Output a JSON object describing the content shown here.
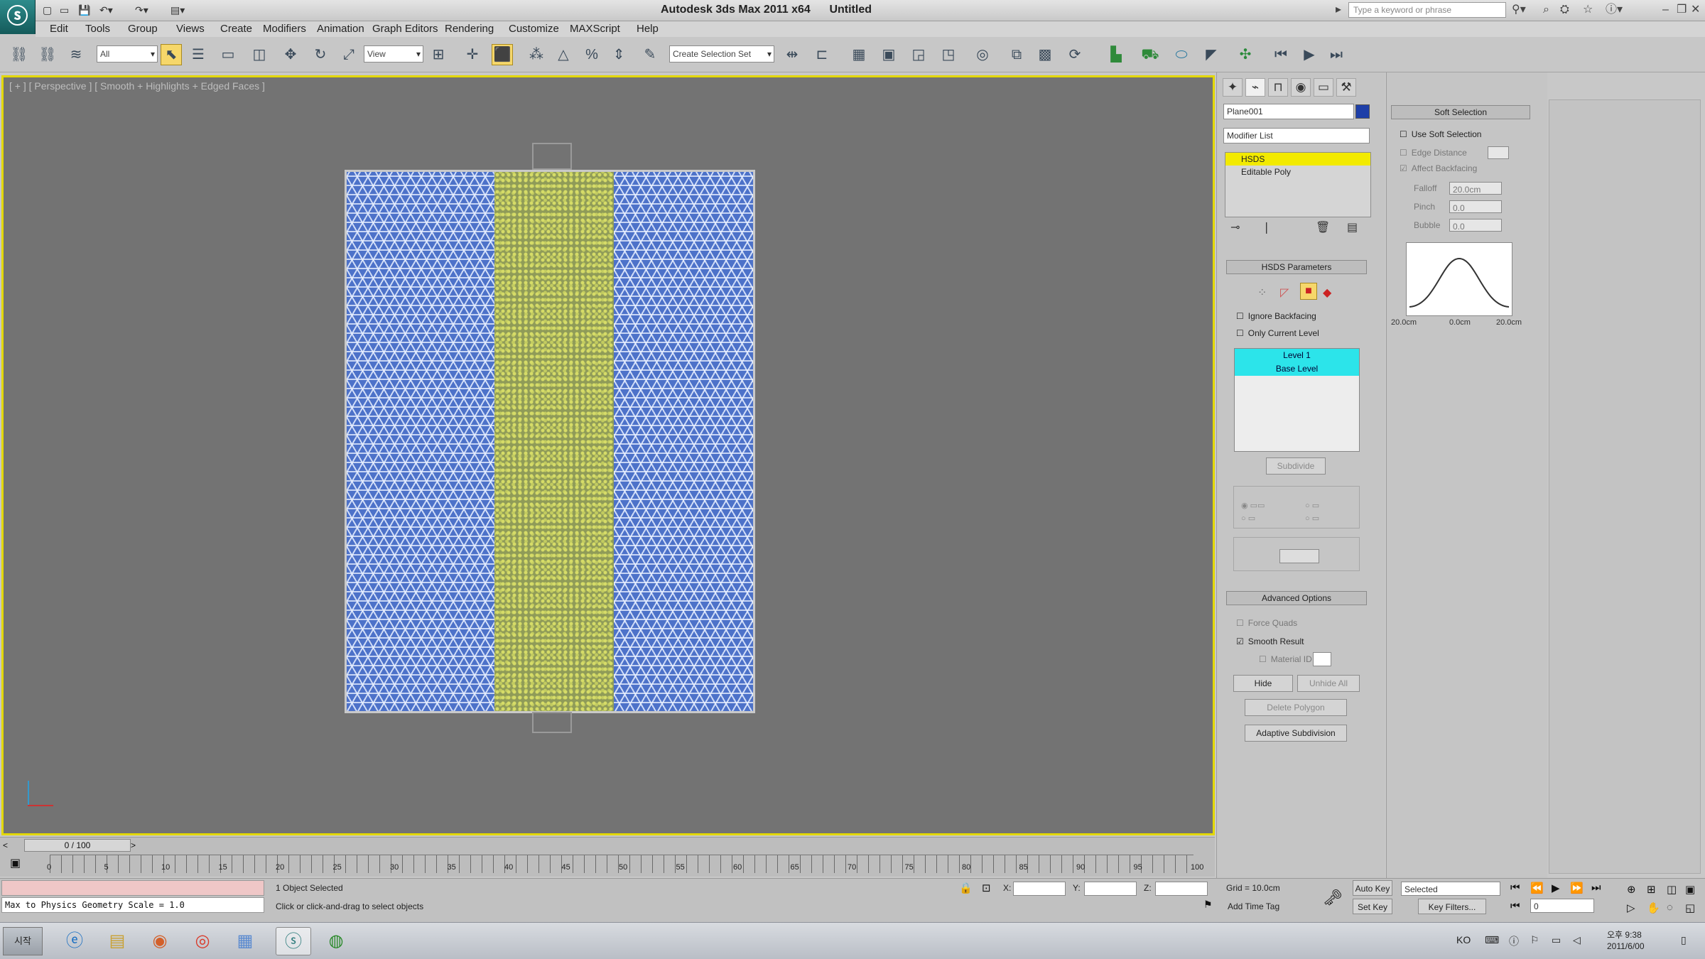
{
  "window": {
    "app_title": "Autodesk 3ds Max 2011 x64",
    "doc_title": "Untitled",
    "search_placeholder": "Type a keyword or phrase"
  },
  "menu": [
    "Edit",
    "Tools",
    "Group",
    "Views",
    "Create",
    "Modifiers",
    "Animation",
    "Graph Editors",
    "Rendering",
    "Customize",
    "MAXScript",
    "Help"
  ],
  "toolbar": {
    "selection_filter": "All",
    "ref_coord": "View",
    "named_selection": "Create Selection Set"
  },
  "viewport": {
    "label": "[ + ] [ Perspective ] [ Smooth + Highlights + Edged Faces ]"
  },
  "modify_panel": {
    "object_name": "Plane001",
    "modifier_list": "Modifier List",
    "stack": [
      "HSDS",
      "Editable Poly"
    ],
    "hsds_rollout": "HSDS Parameters",
    "ignore_backfacing": "Ignore Backfacing",
    "only_current_level": "Only Current Level",
    "levels": [
      "Level 1",
      "Base Level"
    ],
    "subdivide": "Subdivide",
    "adv_rollout": "Advanced Options",
    "force_quads": "Force Quads",
    "smooth_result": "Smooth Result",
    "material_id": "Material ID",
    "hide": "Hide",
    "unhide_all": "Unhide All",
    "delete_polygon": "Delete Polygon",
    "adaptive_subdivision": "Adaptive Subdivision"
  },
  "soft_selection": {
    "title": "Soft Selection",
    "use_soft": "Use Soft Selection",
    "edge_distance": "Edge Distance",
    "affect_backfacing": "Affect Backfacing",
    "falloff_label": "Falloff",
    "falloff_value": "20.0cm",
    "pinch_label": "Pinch",
    "pinch_value": "0.0",
    "bubble_label": "Bubble",
    "bubble_value": "0.0",
    "curve_labels": [
      "20.0cm",
      "0.0cm",
      "20.0cm"
    ]
  },
  "timeline": {
    "slider": "0 / 100",
    "ticks": [
      "0",
      "5",
      "10",
      "15",
      "20",
      "25",
      "30",
      "35",
      "40",
      "45",
      "50",
      "55",
      "60",
      "65",
      "70",
      "75",
      "80",
      "85",
      "90",
      "95",
      "100"
    ]
  },
  "status": {
    "maxscript_line": "Max to Physics Geometry Scale = 1.0",
    "objects_selected": "1 Object Selected",
    "prompt": "Click or click-and-drag to select objects",
    "grid": "Grid = 10.0cm",
    "add_time_tag": "Add Time Tag",
    "auto_key": "Auto Key",
    "set_key": "Set Key",
    "key_mode": "Selected",
    "key_filters": "Key Filters...",
    "frame": "0"
  },
  "taskbar": {
    "start": "시작",
    "clock_time": "오후 9:38",
    "clock_date": "2011/6/00"
  },
  "colors": {
    "viewport_bg": "#737373",
    "mesh_blue": "#4d72c9",
    "mesh_yellow": "#a2ac5c",
    "highlight": "#f2ea00",
    "level_cyan": "#2ce4ea"
  }
}
